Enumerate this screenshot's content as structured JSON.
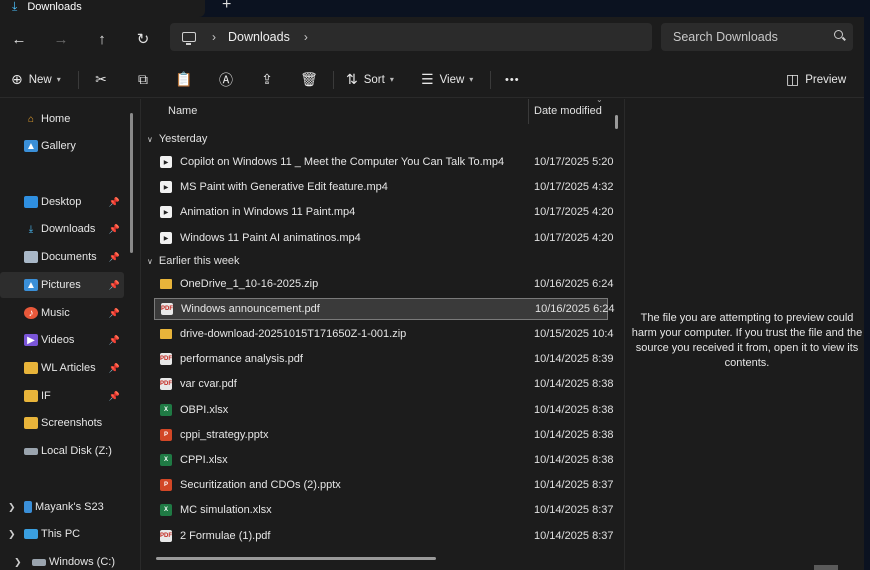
{
  "tab": {
    "title": "Downloads",
    "new_tab": "+",
    "close": "✕"
  },
  "nav": {
    "back": "←",
    "forward": "→",
    "up": "↑",
    "refresh": "↻"
  },
  "address": {
    "crumb": "Downloads",
    "sep": "›"
  },
  "search": {
    "placeholder": "Search Downloads"
  },
  "toolbar": {
    "new_label": "New",
    "sort_label": "Sort",
    "view_label": "View",
    "more": "•••",
    "preview_label": "Preview"
  },
  "sidebar": {
    "items": [
      {
        "label": "Home",
        "icon": "home-icon"
      },
      {
        "label": "Gallery",
        "icon": "gallery-icon"
      },
      {
        "label": "Desktop",
        "icon": "desktop-icon"
      },
      {
        "label": "Downloads",
        "icon": "download-icon"
      },
      {
        "label": "Documents",
        "icon": "documents-icon"
      },
      {
        "label": "Pictures",
        "icon": "pictures-icon"
      },
      {
        "label": "Music",
        "icon": "music-icon"
      },
      {
        "label": "Videos",
        "icon": "videos-icon"
      },
      {
        "label": "WL Articles",
        "icon": "folder-icon"
      },
      {
        "label": "IF",
        "icon": "folder-icon"
      },
      {
        "label": "Screenshots",
        "icon": "folder-icon"
      },
      {
        "label": "Local Disk (Z:)",
        "icon": "drive-icon"
      },
      {
        "label": "Mayank's S23",
        "icon": "phone-icon"
      },
      {
        "label": "This PC",
        "icon": "pc-icon"
      },
      {
        "label": "Windows (C:)",
        "icon": "drive-icon"
      }
    ]
  },
  "columns": {
    "name": "Name",
    "date": "Date modified"
  },
  "groups": {
    "yesterday": "Yesterday",
    "earlier": "Earlier this week"
  },
  "files": [
    {
      "name": "Copilot on Windows 11 _ Meet the Computer You Can Talk To.mp4",
      "date": "10/17/2025 5:20",
      "type": "mp4"
    },
    {
      "name": "MS Paint with Generative Edit feature.mp4",
      "date": "10/17/2025 4:32",
      "type": "mp4"
    },
    {
      "name": "Animation in Windows 11 Paint.mp4",
      "date": "10/17/2025 4:20",
      "type": "mp4"
    },
    {
      "name": "Windows 11 Paint AI animatinos.mp4",
      "date": "10/17/2025 4:20",
      "type": "mp4"
    },
    {
      "name": "OneDrive_1_10-16-2025.zip",
      "date": "10/16/2025 6:24",
      "type": "zip"
    },
    {
      "name": "Windows announcement.pdf",
      "date": "10/16/2025 6:24",
      "type": "pdf"
    },
    {
      "name": "drive-download-20251015T171650Z-1-001.zip",
      "date": "10/15/2025 10:4",
      "type": "zip"
    },
    {
      "name": "performance analysis.pdf",
      "date": "10/14/2025 8:39",
      "type": "pdf"
    },
    {
      "name": "var cvar.pdf",
      "date": "10/14/2025 8:38",
      "type": "pdf"
    },
    {
      "name": "OBPI.xlsx",
      "date": "10/14/2025 8:38",
      "type": "xlsx"
    },
    {
      "name": "cppi_strategy.pptx",
      "date": "10/14/2025 8:38",
      "type": "pptx"
    },
    {
      "name": "CPPI.xlsx",
      "date": "10/14/2025 8:38",
      "type": "xlsx"
    },
    {
      "name": "Securitization and CDOs (2).pptx",
      "date": "10/14/2025 8:37",
      "type": "pptx"
    },
    {
      "name": "MC simulation.xlsx",
      "date": "10/14/2025 8:37",
      "type": "xlsx"
    },
    {
      "name": "2 Formulae (1).pdf",
      "date": "10/14/2025 8:37",
      "type": "pdf"
    }
  ],
  "preview": {
    "message": "The file you are attempting to preview could harm your computer. If you trust the file and the source you received it from, open it to view its contents."
  },
  "colors": {
    "accent": "#4cc2ff",
    "background": "#1c1c1c",
    "selection": "#3a3a3a"
  }
}
